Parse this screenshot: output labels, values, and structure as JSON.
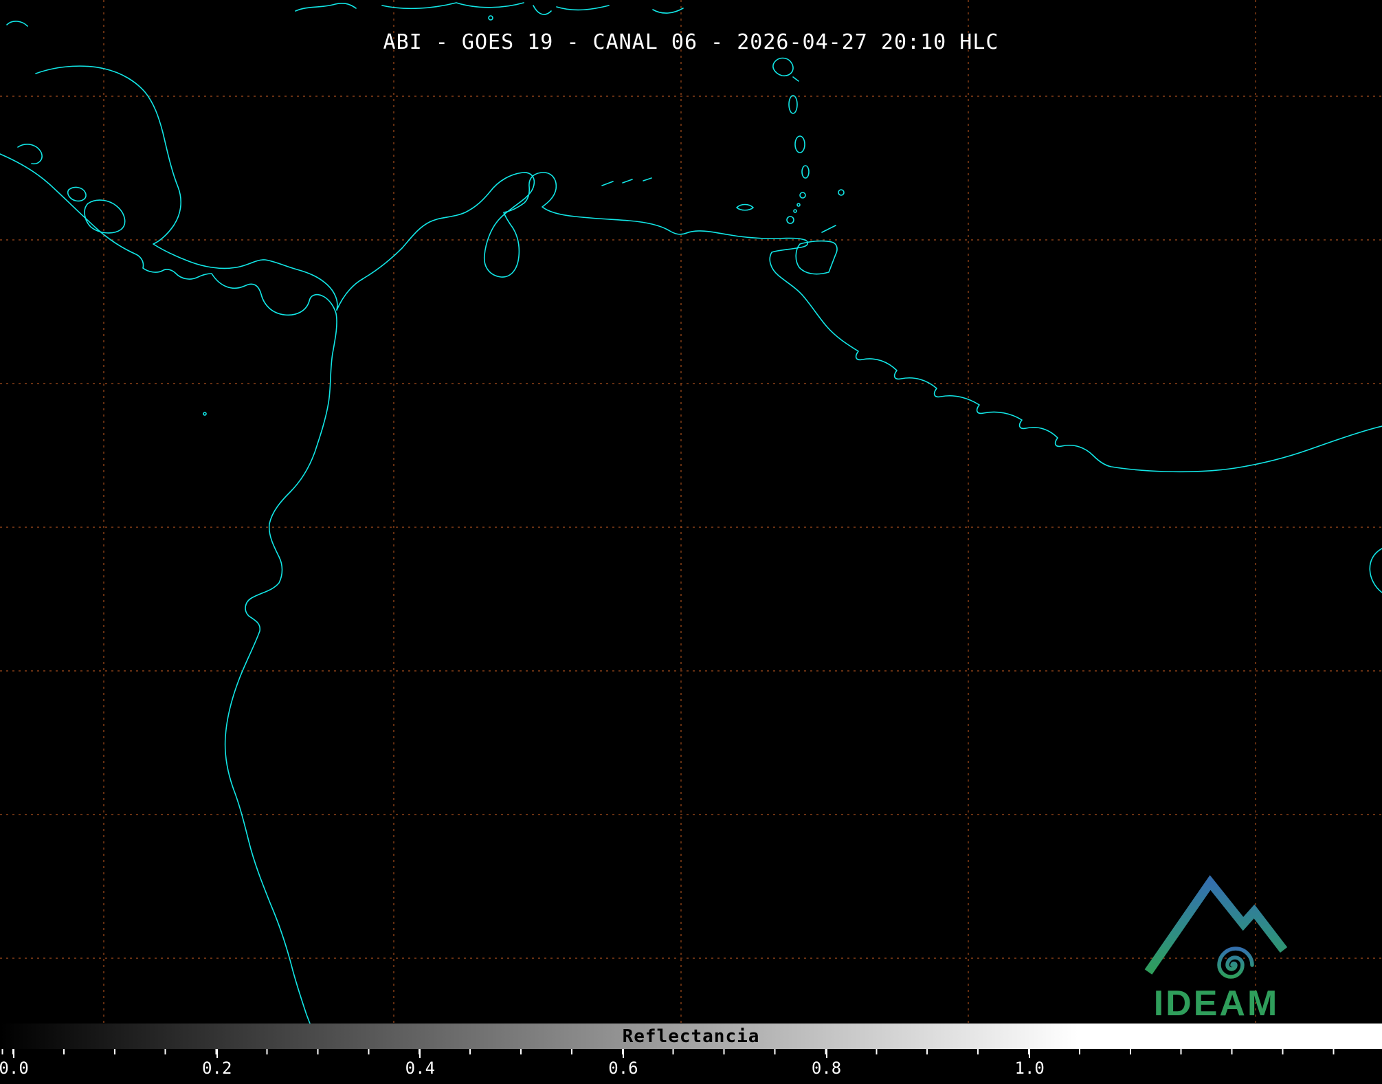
{
  "header": {
    "title": "ABI - GOES 19 - CANAL 06 - 2026-04-27 20:10 HLC"
  },
  "colorbar": {
    "label": "Reflectancia",
    "ticks": [
      "0.0",
      "0.2",
      "0.4",
      "0.6",
      "0.8",
      "1.0"
    ]
  },
  "logo": {
    "text": "IDEAM",
    "icon": "ideam-mountain-spiral-logo"
  },
  "map": {
    "description": "GOES-19 ABI channel 06 reflectance satellite scene over Central America and northern South America",
    "overlays": [
      "cyan-coastlines",
      "orange-dashed-graticule"
    ]
  },
  "colors": {
    "background": "#000000",
    "coastline": "#12e6e6",
    "graticule": "#b0501e",
    "title_text": "#ffffff",
    "tick_text": "#ffffff",
    "colorbar_label": "#000000",
    "logo_blue": "#3470ae",
    "logo_teal": "#2f8d85",
    "logo_green": "#2f9e5b"
  }
}
